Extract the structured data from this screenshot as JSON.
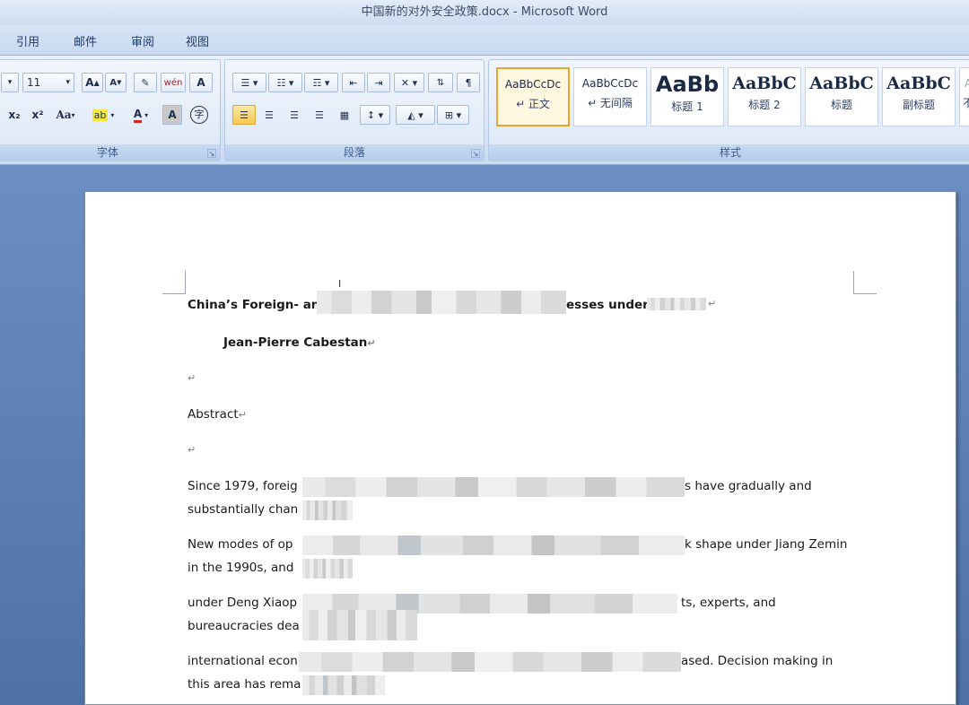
{
  "window": {
    "title_doc": "中国新的对外安全政策.docx",
    "title_sep": " - ",
    "title_app": "Microsoft Word"
  },
  "ribbon_tabs": [
    "引用",
    "邮件",
    "审阅",
    "视图"
  ],
  "font_group": {
    "size_value": "11",
    "label": "字体",
    "grow_label": "A",
    "shrink_label": "A",
    "subscript_label": "x₂",
    "superscript_label": "x²",
    "case_label": "Aa",
    "highlight_label": "ab",
    "color_label": "A",
    "shade_label": "A",
    "phonetic_label": "wén",
    "border_label": "A",
    "enclose_label": "字"
  },
  "paragraph_group": {
    "label": "段落"
  },
  "styles_group": {
    "label": "样式",
    "styles": [
      {
        "sample": "AaBbCcDc",
        "name": "↵ 正文"
      },
      {
        "sample": "AaBbCcDc",
        "name": "↵ 无间隔"
      },
      {
        "sample": "AaBb",
        "name": "标题 1"
      },
      {
        "sample": "AaBbC",
        "name": "标题 2"
      },
      {
        "sample": "AaBbC",
        "name": "标题"
      },
      {
        "sample": "AaBbC",
        "name": "副标题"
      }
    ],
    "partial_name": "不"
  },
  "document": {
    "title_start": "China’s Foreign- and",
    "title_mid": "esses under",
    "author": "Jean-Pierre Cabestan",
    "heading": "Abstract",
    "para_mark": "↵",
    "lines": [
      {
        "start": "Since 1979, foreig",
        "end": "s have gradually and"
      },
      {
        "start": "substantially chan",
        "end": ""
      },
      {
        "start": "New modes of op",
        "end": "k shape under Jiang Zemin"
      },
      {
        "start": "in the 1990s, and",
        "end": ""
      },
      {
        "start": "under Deng Xiaop",
        "end": "ts, experts, and"
      },
      {
        "start": "bureaucracies dea",
        "end": ""
      },
      {
        "start": "international econ",
        "end": "ased. Decision making in"
      },
      {
        "start": "this area has rema",
        "end": ""
      }
    ]
  }
}
